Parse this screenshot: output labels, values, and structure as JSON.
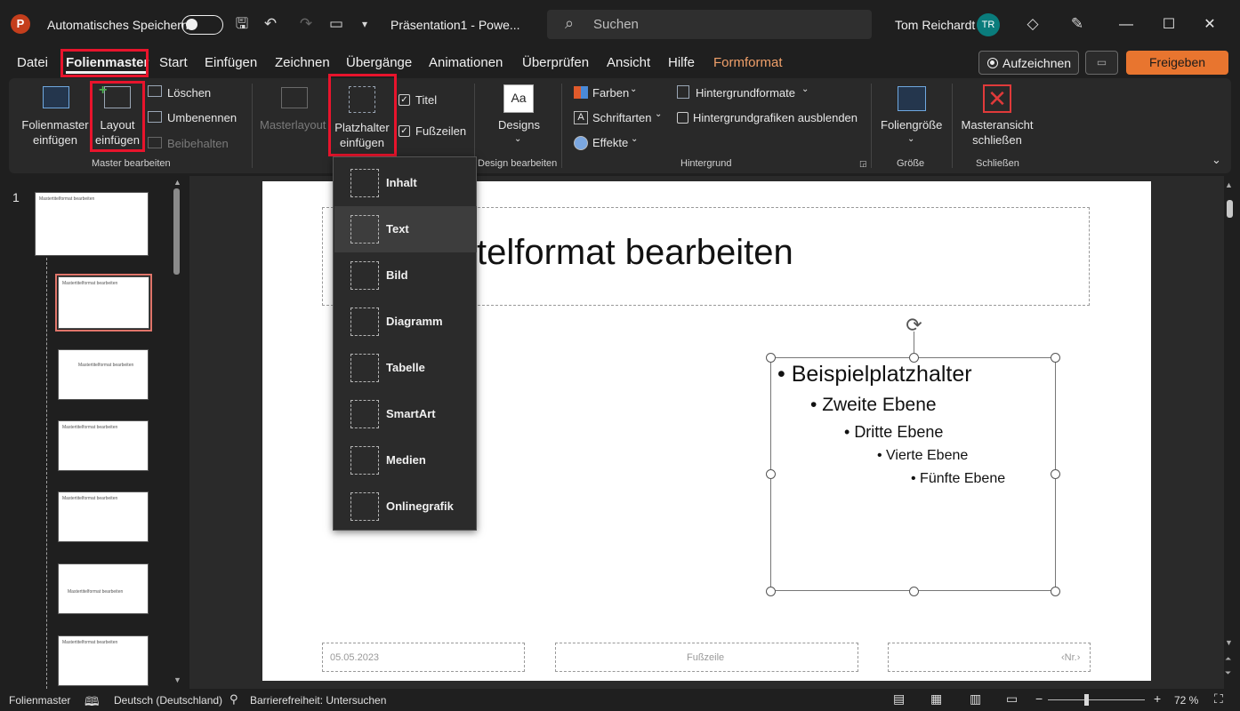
{
  "titlebar": {
    "logo_letter": "P",
    "autosave_label": "Automatisches Speichern",
    "doc_title": "Präsentation1  -  Powe...",
    "search_placeholder": "Suchen",
    "user_name": "Tom Reichardt",
    "user_initials": "TR"
  },
  "menu": {
    "items": [
      "Datei",
      "Folienmaster",
      "Start",
      "Einfügen",
      "Zeichnen",
      "Übergänge",
      "Animationen",
      "Überprüfen",
      "Ansicht",
      "Hilfe",
      "Formformat"
    ],
    "active": "Folienmaster",
    "record_label": "Aufzeichnen",
    "share_label": "Freigeben"
  },
  "ribbon": {
    "insert_master": "Folienmaster\neinfügen",
    "insert_layout": "Layout\neinfügen",
    "delete": "Löschen",
    "rename": "Umbenennen",
    "preserve": "Beibehalten",
    "group_master": "Master bearbeiten",
    "master_layout": "Masterlayout",
    "insert_placeholder": "Platzhalter\neinfügen",
    "title_check": "Titel",
    "footer_check": "Fußzeilen",
    "designs": "Designs",
    "group_design": "Design bearbeiten",
    "colors": "Farben",
    "fonts": "Schriftarten",
    "effects": "Effekte",
    "background_styles": "Hintergrundformate",
    "hide_bg_graphics": "Hintergrundgrafiken ausblenden",
    "group_background": "Hintergrund",
    "slide_size": "Foliengröße",
    "group_size": "Größe",
    "close_master": "Masteransicht\nschließen",
    "group_close": "Schließen"
  },
  "placeholder_menu": {
    "items": [
      "Inhalt",
      "Text",
      "Bild",
      "Diagramm",
      "Tabelle",
      "SmartArt",
      "Medien",
      "Onlinegrafik"
    ],
    "highlighted": "Text"
  },
  "panel": {
    "slide_number": "1",
    "thumb_title": "Mastertitelformat bearbeiten"
  },
  "slide": {
    "title": "telformat bearbeiten",
    "levels": [
      "Beispielplatzhalter",
      "Zweite Ebene",
      "Dritte Ebene",
      "Vierte Ebene",
      "Fünfte Ebene"
    ],
    "date": "05.05.2023",
    "footer": "Fußzeile",
    "number": "‹Nr.›"
  },
  "statusbar": {
    "view": "Folienmaster",
    "language": "Deutsch (Deutschland)",
    "accessibility": "Barrierefreiheit: Untersuchen",
    "zoom": "72 %"
  },
  "colors": {
    "accent_red_highlight": "#e8142c",
    "share_button": "#e8752f",
    "format_tab": "#f0a06a",
    "avatar": "#0a7c7c"
  }
}
